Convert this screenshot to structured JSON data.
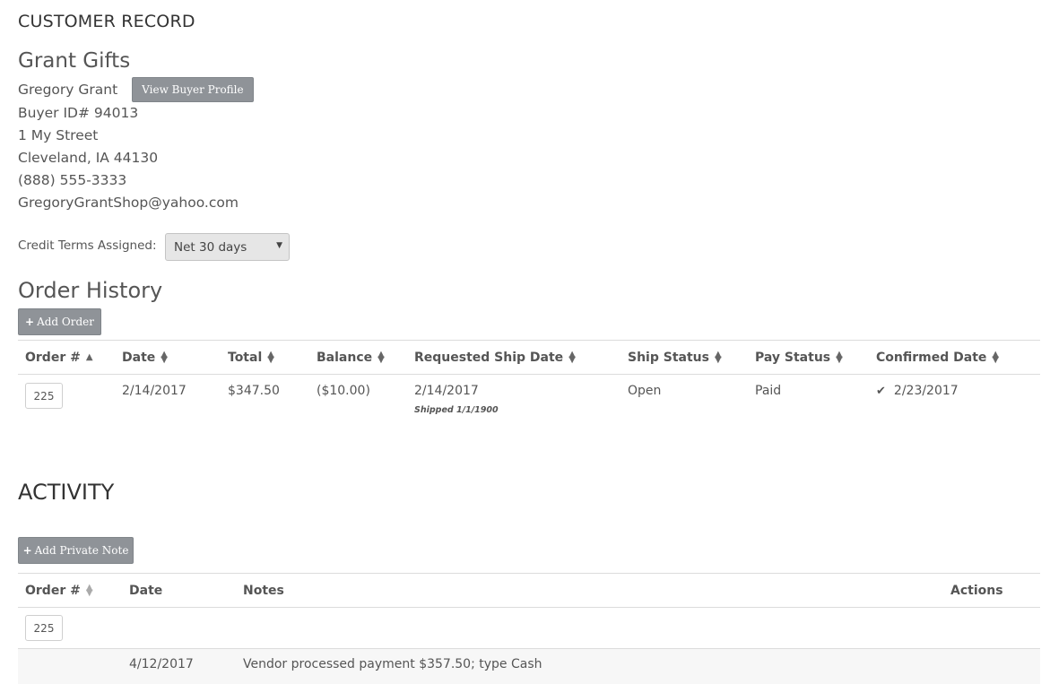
{
  "page_title": "CUSTOMER RECORD",
  "customer": {
    "company": "Grant Gifts",
    "name": "Gregory Grant",
    "view_profile_label": "View Buyer Profile",
    "buyer_id": "Buyer ID# 94013",
    "street": "1 My Street",
    "city_state_zip": "Cleveland, IA 44130",
    "phone": "(888) 555-3333",
    "email": "GregoryGrantShop@yahoo.com"
  },
  "credit": {
    "label": "Credit Terms Assigned:",
    "selected": "Net 30 days"
  },
  "order_history": {
    "title": "Order History",
    "add_label": "Add Order",
    "columns": [
      "Order #",
      "Date",
      "Total",
      "Balance",
      "Requested Ship Date",
      "Ship Status",
      "Pay Status",
      "Confirmed Date"
    ],
    "rows": [
      {
        "order": "225",
        "date": "2/14/2017",
        "total": "$347.50",
        "balance": "($10.00)",
        "requested_ship": "2/14/2017",
        "shipped_note": "Shipped 1/1/1900",
        "ship_status": "Open",
        "pay_status": "Paid",
        "confirmed_date": "2/23/2017"
      }
    ]
  },
  "activity": {
    "title": "ACTIVITY",
    "add_note_label": "Add Private Note",
    "columns": [
      "Order #",
      "Date",
      "Notes",
      "Actions"
    ],
    "group_order": "225",
    "rows": [
      {
        "date": "4/12/2017",
        "note": "Vendor processed payment $357.50; type Cash"
      }
    ]
  },
  "icons": {
    "plus": "plus-icon",
    "sort": "sort-icon",
    "sort_asc": "sort-asc-icon",
    "check": "check-icon",
    "caret": "caret-down-icon"
  }
}
